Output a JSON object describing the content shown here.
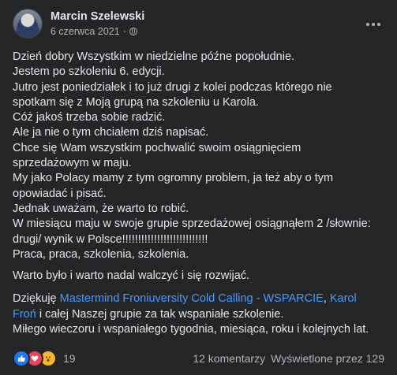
{
  "post": {
    "author": "Marcin Szelewski",
    "date": "6 czerwca 2021",
    "separator": "·",
    "icons": [
      "globe-icon",
      "more-icon",
      "like-icon",
      "love-icon",
      "wow-icon"
    ]
  },
  "text": {
    "l1": "Dzień dobry Wszystkim w niedzielne późne popołudnie.",
    "l2": "Jestem po szkoleniu 6. edycji.",
    "l3": "Jutro jest poniedziałek i to już drugi z kolei podczas którego nie",
    "l4": "spotkam się z Moją grupą na szkoleniu u Karola.",
    "l5": "Cóż jakoś trzeba sobie radzić.",
    "l6": "Ale ja nie o tym chciałem dziś napisać.",
    "l7": "Chce się Wam wszystkim pochwalić swoim osiągnięciem",
    "l8": "sprzedażowym w maju.",
    "l9": "My jako Polacy mamy z tym ogromny problem, ja też aby o tym",
    "l10": "opowiadać i pisać.",
    "l11": "Jednak uważam, że warto to robić.",
    "l12": "W miesiącu maju w swoje grupie sprzedażowej osiągnąłem 2 /słownie:",
    "l13": "drugi/ wynik w Polsce!!!!!!!!!!!!!!!!!!!!!!!!!!!",
    "l14": "Praca, praca, szkolenia, szkolenia.",
    "l15": "Warto było i warto nadal walczyć i się rozwijać.",
    "l16_a": "Dziękuję ",
    "l16_link1": "Mastermind Froniuversity Cold Calling - WSPARCIE",
    "l16_b": ", ",
    "l16_link2a": "Karol",
    "l17_link2b": "Froń",
    "l17_rest": " i całej Naszej grupie za tak wspaniałe szkolenie.",
    "l18": "Miłego wieczoru i wspaniałego tygodnia, miesiąca, roku i kolejnych lat."
  },
  "footer": {
    "reaction_count": "19",
    "comments": "12 komentarzy",
    "views": "Wyświetlone przez 129"
  },
  "colors": {
    "background": "#242526",
    "text": "#e4e6eb",
    "secondary": "#b0b3b8",
    "link": "#4599ff",
    "like": "#1877f2",
    "love": "#f33e58",
    "wow": "#f7b928"
  }
}
